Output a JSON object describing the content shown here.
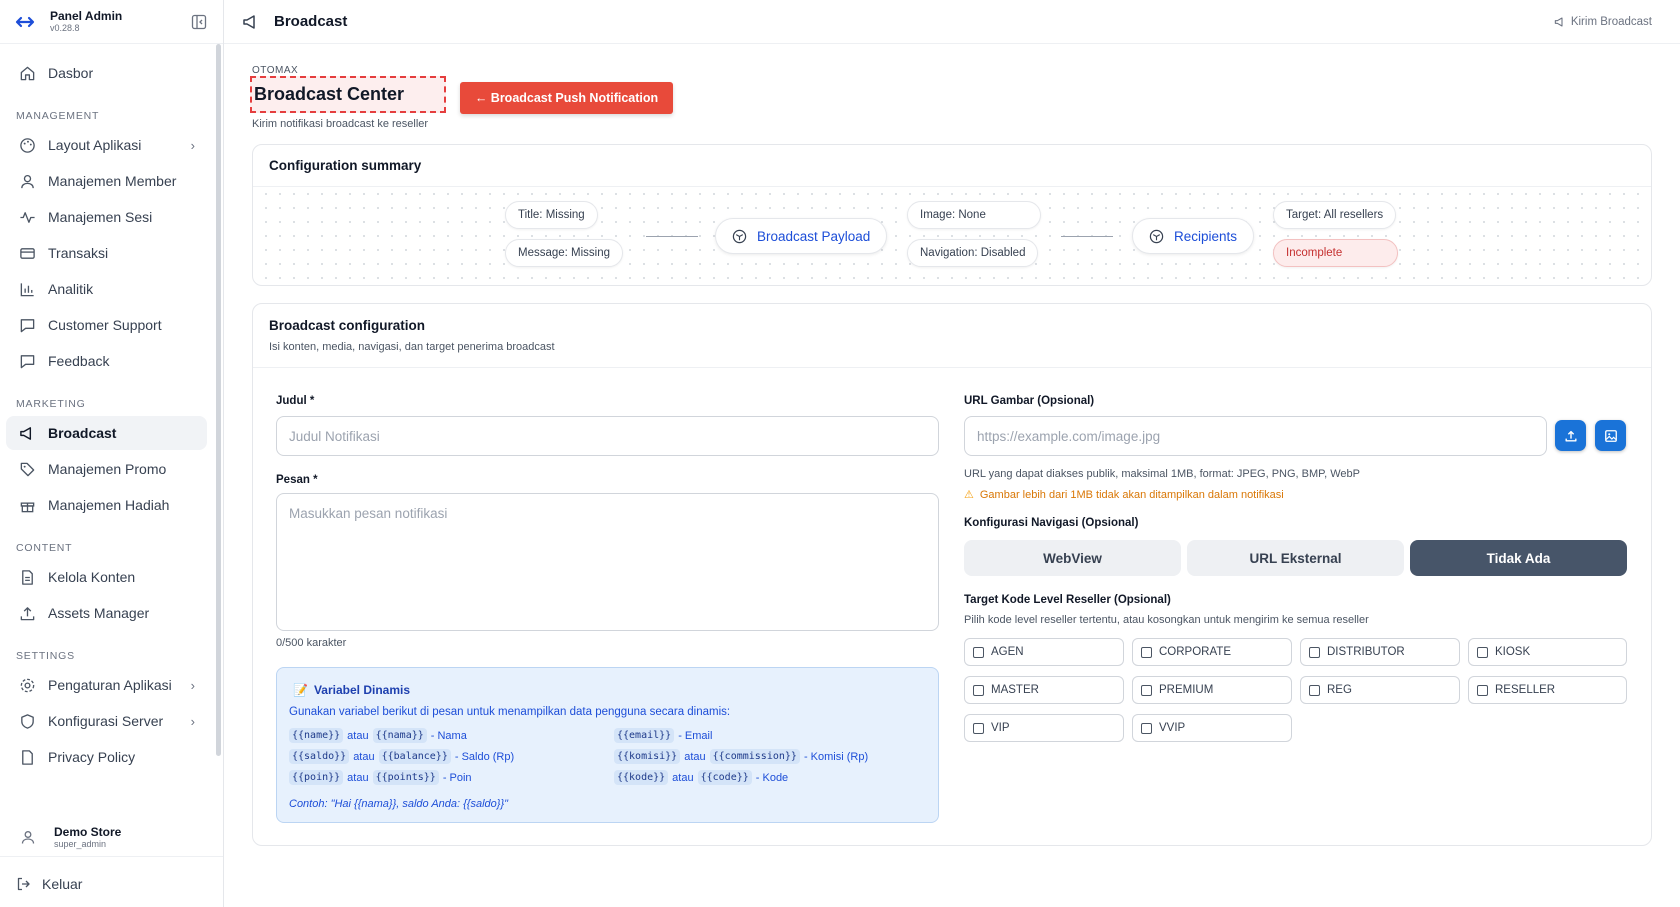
{
  "sidebar": {
    "brand": {
      "name": "Panel Admin",
      "version": "v0.28.8"
    },
    "dashboard": "Dasbor",
    "sections": {
      "management": "MANAGEMENT",
      "marketing": "MARKETING",
      "content": "CONTENT",
      "settings": "SETTINGS"
    },
    "management_items": [
      {
        "label": "Layout Aplikasi",
        "icon": "palette-icon",
        "has_submenu": true
      },
      {
        "label": "Manajemen Member",
        "icon": "user-icon"
      },
      {
        "label": "Manajemen Sesi",
        "icon": "activity-icon"
      },
      {
        "label": "Transaksi",
        "icon": "credit-card-icon"
      },
      {
        "label": "Analitik",
        "icon": "bar-chart-icon"
      },
      {
        "label": "Customer Support",
        "icon": "message-icon"
      },
      {
        "label": "Feedback",
        "icon": "message-square-icon"
      }
    ],
    "marketing_items": [
      {
        "label": "Broadcast",
        "icon": "megaphone-icon",
        "active": true
      },
      {
        "label": "Manajemen Promo",
        "icon": "tag-icon"
      },
      {
        "label": "Manajemen Hadiah",
        "icon": "gift-icon"
      }
    ],
    "content_items": [
      {
        "label": "Kelola Konten",
        "icon": "file-text-icon"
      },
      {
        "label": "Assets Manager",
        "icon": "upload-icon"
      }
    ],
    "settings_items": [
      {
        "label": "Pengaturan Aplikasi",
        "icon": "settings-icon",
        "has_submenu": true
      },
      {
        "label": "Konfigurasi Server",
        "icon": "shield-icon",
        "has_submenu": true
      },
      {
        "label": "Privacy Policy",
        "icon": "file-icon"
      }
    ],
    "user": {
      "name": "Demo Store",
      "role": "super_admin"
    },
    "logout": "Keluar"
  },
  "topbar": {
    "title": "Broadcast",
    "action": "Kirim Broadcast"
  },
  "page": {
    "eyebrow": "OTOMAX",
    "title": "Broadcast Center",
    "push_button": "← Broadcast Push Notification",
    "subtitle": "Kirim notifikasi broadcast ke reseller"
  },
  "summary": {
    "title": "Configuration summary",
    "title_pill": "Title: Missing",
    "message_pill": "Message: Missing",
    "payload_node": "Broadcast Payload",
    "image_pill": "Image: None",
    "navigation_pill": "Navigation: Disabled",
    "recipients_node": "Recipients",
    "target_pill": "Target: All resellers",
    "status_pill": "Incomplete",
    "status_color": "#c53030"
  },
  "config": {
    "title": "Broadcast configuration",
    "subtitle": "Isi konten, media, navigasi, dan target penerima broadcast",
    "judul_label": "Judul *",
    "judul_placeholder": "Judul Notifikasi",
    "pesan_label": "Pesan *",
    "pesan_placeholder": "Masukkan pesan notifikasi",
    "char_count": "0/500 karakter",
    "variables": {
      "title": "Variabel Dinamis",
      "description": "Gunakan variabel berikut di pesan untuk menampilkan data pengguna secara dinamis:",
      "name_a": "{{name}}",
      "name_b": "{{nama}}",
      "name_desc": "- Nama",
      "saldo_a": "{{saldo}}",
      "saldo_b": "{{balance}}",
      "saldo_desc": "- Saldo (Rp)",
      "poin_a": "{{poin}}",
      "poin_b": "{{points}}",
      "poin_desc": "- Poin",
      "email_a": "{{email}}",
      "email_desc": "- Email",
      "komisi_a": "{{komisi}}",
      "komisi_b": "{{commission}}",
      "komisi_desc": "- Komisi (Rp)",
      "kode_a": "{{kode}}",
      "kode_b": "{{code}}",
      "kode_desc": "- Kode",
      "or": "atau",
      "example": "Contoh: \"Hai {{nama}}, saldo Anda: {{saldo}}\""
    },
    "image_label": "URL Gambar (Opsional)",
    "image_placeholder": "https://example.com/image.jpg",
    "image_hint": "URL yang dapat diakses publik, maksimal 1MB, format: JPEG, PNG, BMP, WebP",
    "image_warning": "Gambar lebih dari 1MB tidak akan ditampilkan dalam notifikasi",
    "nav_label": "Konfigurasi Navigasi (Opsional)",
    "nav_options": [
      "WebView",
      "URL Eksternal",
      "Tidak Ada"
    ],
    "nav_selected": "Tidak Ada",
    "target_label": "Target Kode Level Reseller (Opsional)",
    "target_hint": "Pilih kode level reseller tertentu, atau kosongkan untuk mengirim ke semua reseller",
    "levels": [
      "AGEN",
      "CORPORATE",
      "DISTRIBUTOR",
      "KIOSK",
      "MASTER",
      "PREMIUM",
      "REG",
      "RESELLER",
      "VIP",
      "VVIP"
    ]
  },
  "colors": {
    "accent_blue": "#1d4ed8",
    "danger": "#e84a3a",
    "active_segment": "#475569"
  }
}
